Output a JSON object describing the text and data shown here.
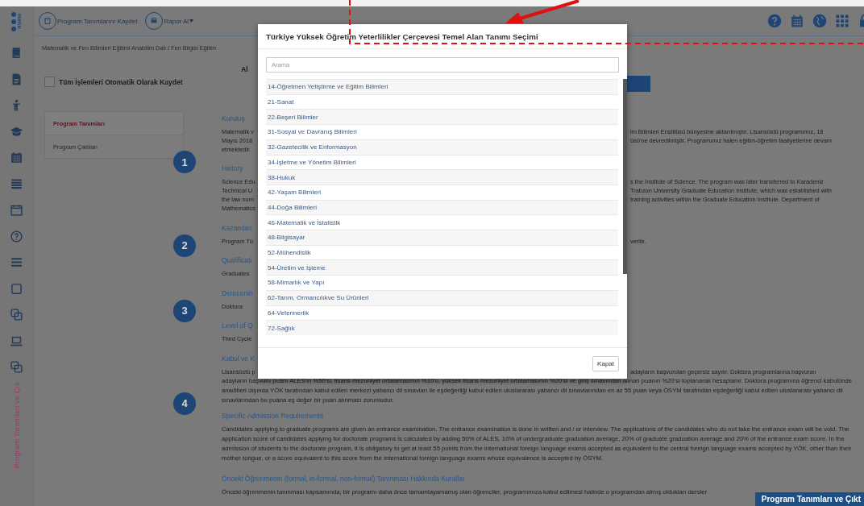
{
  "header": {
    "logo_text": "menu",
    "buttons": [
      {
        "kind": "save",
        "label": "Program Tanımlarını Kaydet"
      },
      {
        "kind": "report",
        "label": "Rapor Al"
      }
    ]
  },
  "sidebar": {
    "vertical_label": "Program Tanımları ve Çık"
  },
  "breadcrumb": "Matematik ve Fen Bilimleri Eğitimi Anabilim Dalı / Fen Bilgisi Eğitim",
  "autosave": {
    "label": "Tüm İşlemleri Otomatik Olarak Kaydet",
    "checked": false
  },
  "field_label": "Al",
  "nav": [
    {
      "label": "Program Tanımları",
      "selected": true
    },
    {
      "label": "Program Çıktıları",
      "selected": false
    }
  ],
  "sections": [
    {
      "number": "1",
      "blocks": [
        {
          "kind": "heading",
          "left": "Kuruluş"
        },
        {
          "kind": "fragment",
          "left": "Matematik v",
          "right": "im Bilimleri Enstitüsü bünyesine aktarılmıştır. Lisansüstü programımız, 18"
        },
        {
          "kind": "fragment",
          "left": "Mayıs 2018",
          "right": "üsü'ne devredilmiştir. Programımız halen eğitim-öğretim faaliyetlerine devam"
        },
        {
          "kind": "fragment",
          "left": "etmektedir."
        },
        {
          "kind": "heading",
          "left": "History"
        },
        {
          "kind": "fragment",
          "left": "Science Edu",
          "right": "s the Institute of Science. The program was later transferred to Karadeniz"
        },
        {
          "kind": "fragment",
          "left": "Technical U",
          "right": "Trabzon University Graduate Education Institute, which was established with"
        },
        {
          "kind": "fragment",
          "left": "the law num",
          "right": "training activities within the Graduate Education Institute. Department of"
        },
        {
          "kind": "fragment",
          "left": "Mathematics"
        }
      ]
    },
    {
      "number": "2",
      "blocks": [
        {
          "kind": "heading",
          "left": "Kazanılan"
        },
        {
          "kind": "fragment",
          "left": "Program Tü",
          "right": "verilir."
        },
        {
          "kind": "heading",
          "left": "Qualificati"
        },
        {
          "kind": "fragment",
          "left": "Graduates"
        }
      ]
    },
    {
      "number": "3",
      "blocks": [
        {
          "kind": "heading",
          "left": "Derecenin"
        },
        {
          "kind": "fragment",
          "left": "Doktora"
        },
        {
          "kind": "heading",
          "left": "Level of Q"
        },
        {
          "kind": "fragment",
          "left": "Third Cycle"
        }
      ]
    },
    {
      "number": "4",
      "blocks": [
        {
          "kind": "heading",
          "left": "Kabul ve K"
        },
        {
          "kind": "fragment",
          "left": "Lisansüstü p",
          "right": "adayların başvuruları geçersiz sayılır. Doktora programlarına başvuran"
        },
        {
          "kind": "paragraph",
          "text": "adayların başvuru puanı ALES'in %50'si, lisans mezuniyet ortalamasının %10'u, yüksek lisans mezuniyet ortalamasının %20'si ve giriş sınavından alınan puanın %20'si toplanarak hesaplanır. Doktora programına öğrenci kabulünde anadilleri dışında YÖK tarafından kabul edilen merkezi yabancı dil sınavları ile eşdeğerliği kabul edilen uluslararası yabancı dil sınavlarından en az 55 puan veya ÖSYM tarafından eşdeğerliği kabul edilen uluslararası yabancı dil sınavlarından bu puana eş değer bir puan alınması zorunludur."
        },
        {
          "kind": "heading",
          "left": "Specific Admission Requirements"
        },
        {
          "kind": "paragraph",
          "text": "Candidates applying to graduate programs are given an entrance examination. The entrance examination is done in written and / or interview. The applications of the candidates who do not take the entrance exam will be void. The application score of candidates applying for doctorate programs is calculated by adding 50% of ALES, 10% of undergraduate graduation average, 20% of graduate graduation average and 20% of the entrance exam score. In the admission of students to the doctorate program, it is obligatory to get at least 55 points from the international foreign language exams accepted as equivalent to the central foreign language exams accepted by YÖK, other than their mother tongue, or a score equivalent to this score from the international foreign language exams whose equivalence is accepted by ÖSYM."
        }
      ]
    },
    {
      "blocks": [
        {
          "kind": "heading",
          "left": "Önceki Öğrenmenin (formal, in-formal, non-formal) Tanınması Hakkında Kurallar"
        },
        {
          "kind": "line",
          "text": "Önceki öğrenmenin tanınması kapsamında; bir programı daha önce tamamlayamamış olan öğrenciler, programımıza kabul edilmesi halinde o programdan almış oldukları dersler"
        }
      ]
    }
  ],
  "floating_tab": "Program Tanımları ve Çıkt",
  "dialog": {
    "title": "Türkiye Yüksek Öğretim Yeterlilikler Çerçevesi Temel Alan Tanımı Seçimi",
    "search": {
      "placeholder": "Arama"
    },
    "options": [
      {
        "label": "14-Öğretmen Yetiştirme ve Eğitim Bilimleri",
        "selected": false
      },
      {
        "label": "21-Sanat",
        "selected": false
      },
      {
        "label": "22-Beşeri Bilimler",
        "selected": false
      },
      {
        "label": "31-Sosyal ve Davranış Bilimleri",
        "selected": false
      },
      {
        "label": "32-Gazetecilik ve Enformasyon",
        "selected": false
      },
      {
        "label": "34-İşletme ve Yönetim Bilimleri",
        "selected": false
      },
      {
        "label": "38-Hukuk",
        "selected": false
      },
      {
        "label": "42-Yaşam Bilimleri",
        "selected": false
      },
      {
        "label": "44-Doğa Bilimleri",
        "selected": false
      },
      {
        "label": "46-Matematik ve İstatistik",
        "selected": false
      },
      {
        "label": "48-Bilgisayar",
        "selected": false
      },
      {
        "label": "52-Mühendislik",
        "selected": false
      },
      {
        "label": "54-Üretim ve İşleme",
        "selected": false
      },
      {
        "label": "58-Mimarlık ve Yapı",
        "selected": false
      },
      {
        "label": "62-Tarım, Ormancılıkve Su Ürünleri",
        "selected": false
      },
      {
        "label": "64-Veterinerlik",
        "selected": false
      },
      {
        "label": "72-Sağlık",
        "selected": false
      }
    ],
    "close_button": "Kapat"
  }
}
